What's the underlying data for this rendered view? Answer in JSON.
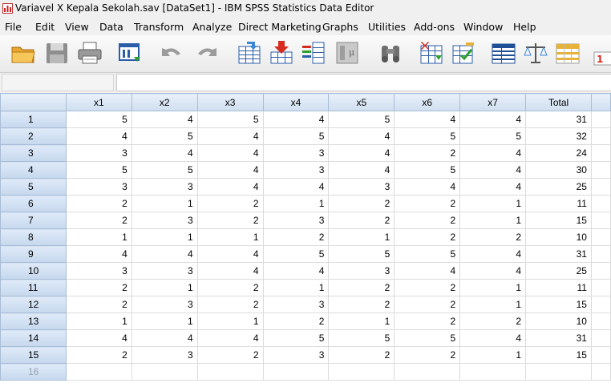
{
  "window": {
    "title": "Variavel X Kepala Sekolah.sav [DataSet1] - IBM SPSS Statistics Data Editor"
  },
  "menu": [
    {
      "label": "File",
      "name": "menu-file"
    },
    {
      "label": "Edit",
      "name": "menu-edit"
    },
    {
      "label": "View",
      "name": "menu-view"
    },
    {
      "label": "Data",
      "name": "menu-data"
    },
    {
      "label": "Transform",
      "name": "menu-transform"
    },
    {
      "label": "Analyze",
      "name": "menu-analyze"
    },
    {
      "label": "Direct Marketing",
      "name": "menu-direct-marketing"
    },
    {
      "label": "Graphs",
      "name": "menu-graphs"
    },
    {
      "label": "Utilities",
      "name": "menu-utilities"
    },
    {
      "label": "Add-ons",
      "name": "menu-add-ons"
    },
    {
      "label": "Window",
      "name": "menu-window"
    },
    {
      "label": "Help",
      "name": "menu-help"
    }
  ],
  "toolbar": [
    "open-folder-icon",
    "save-disk-icon",
    "print-icon",
    "dialog-recall-icon",
    "undo-icon",
    "redo-icon",
    "go-to-case-icon",
    "go-to-variable-icon",
    "variables-icon",
    "run-descriptives-icon",
    "find-icon",
    "insert-cases-icon",
    "insert-variable-icon",
    "split-file-icon",
    "weight-cases-icon",
    "select-cases-icon",
    "value-labels-icon"
  ],
  "cell_editor": {
    "cell_ref": "",
    "cell_value": ""
  },
  "grid": {
    "columns": [
      "x1",
      "x2",
      "x3",
      "x4",
      "x5",
      "x6",
      "x7",
      "Total",
      ""
    ],
    "rows": [
      {
        "n": "1",
        "v": [
          "5",
          "4",
          "5",
          "4",
          "5",
          "4",
          "4",
          "31"
        ]
      },
      {
        "n": "2",
        "v": [
          "4",
          "5",
          "4",
          "5",
          "4",
          "5",
          "5",
          "32"
        ]
      },
      {
        "n": "3",
        "v": [
          "3",
          "4",
          "4",
          "3",
          "4",
          "2",
          "4",
          "24"
        ]
      },
      {
        "n": "4",
        "v": [
          "5",
          "5",
          "4",
          "3",
          "4",
          "5",
          "4",
          "30"
        ]
      },
      {
        "n": "5",
        "v": [
          "3",
          "3",
          "4",
          "4",
          "3",
          "4",
          "4",
          "25"
        ]
      },
      {
        "n": "6",
        "v": [
          "2",
          "1",
          "2",
          "1",
          "2",
          "2",
          "1",
          "11"
        ]
      },
      {
        "n": "7",
        "v": [
          "2",
          "3",
          "2",
          "3",
          "2",
          "2",
          "1",
          "15"
        ]
      },
      {
        "n": "8",
        "v": [
          "1",
          "1",
          "1",
          "2",
          "1",
          "2",
          "2",
          "10"
        ]
      },
      {
        "n": "9",
        "v": [
          "4",
          "4",
          "4",
          "5",
          "5",
          "5",
          "4",
          "31"
        ]
      },
      {
        "n": "10",
        "v": [
          "3",
          "3",
          "4",
          "4",
          "3",
          "4",
          "4",
          "25"
        ]
      },
      {
        "n": "11",
        "v": [
          "2",
          "1",
          "2",
          "1",
          "2",
          "2",
          "1",
          "11"
        ]
      },
      {
        "n": "12",
        "v": [
          "2",
          "3",
          "2",
          "3",
          "2",
          "2",
          "1",
          "15"
        ]
      },
      {
        "n": "13",
        "v": [
          "1",
          "1",
          "1",
          "2",
          "1",
          "2",
          "2",
          "10"
        ]
      },
      {
        "n": "14",
        "v": [
          "4",
          "4",
          "4",
          "5",
          "5",
          "5",
          "4",
          "31"
        ]
      },
      {
        "n": "15",
        "v": [
          "2",
          "3",
          "2",
          "3",
          "2",
          "2",
          "1",
          "15"
        ]
      },
      {
        "n": "16",
        "v": [
          "",
          "",
          "",
          "",
          "",
          "",
          "",
          ""
        ]
      }
    ]
  }
}
